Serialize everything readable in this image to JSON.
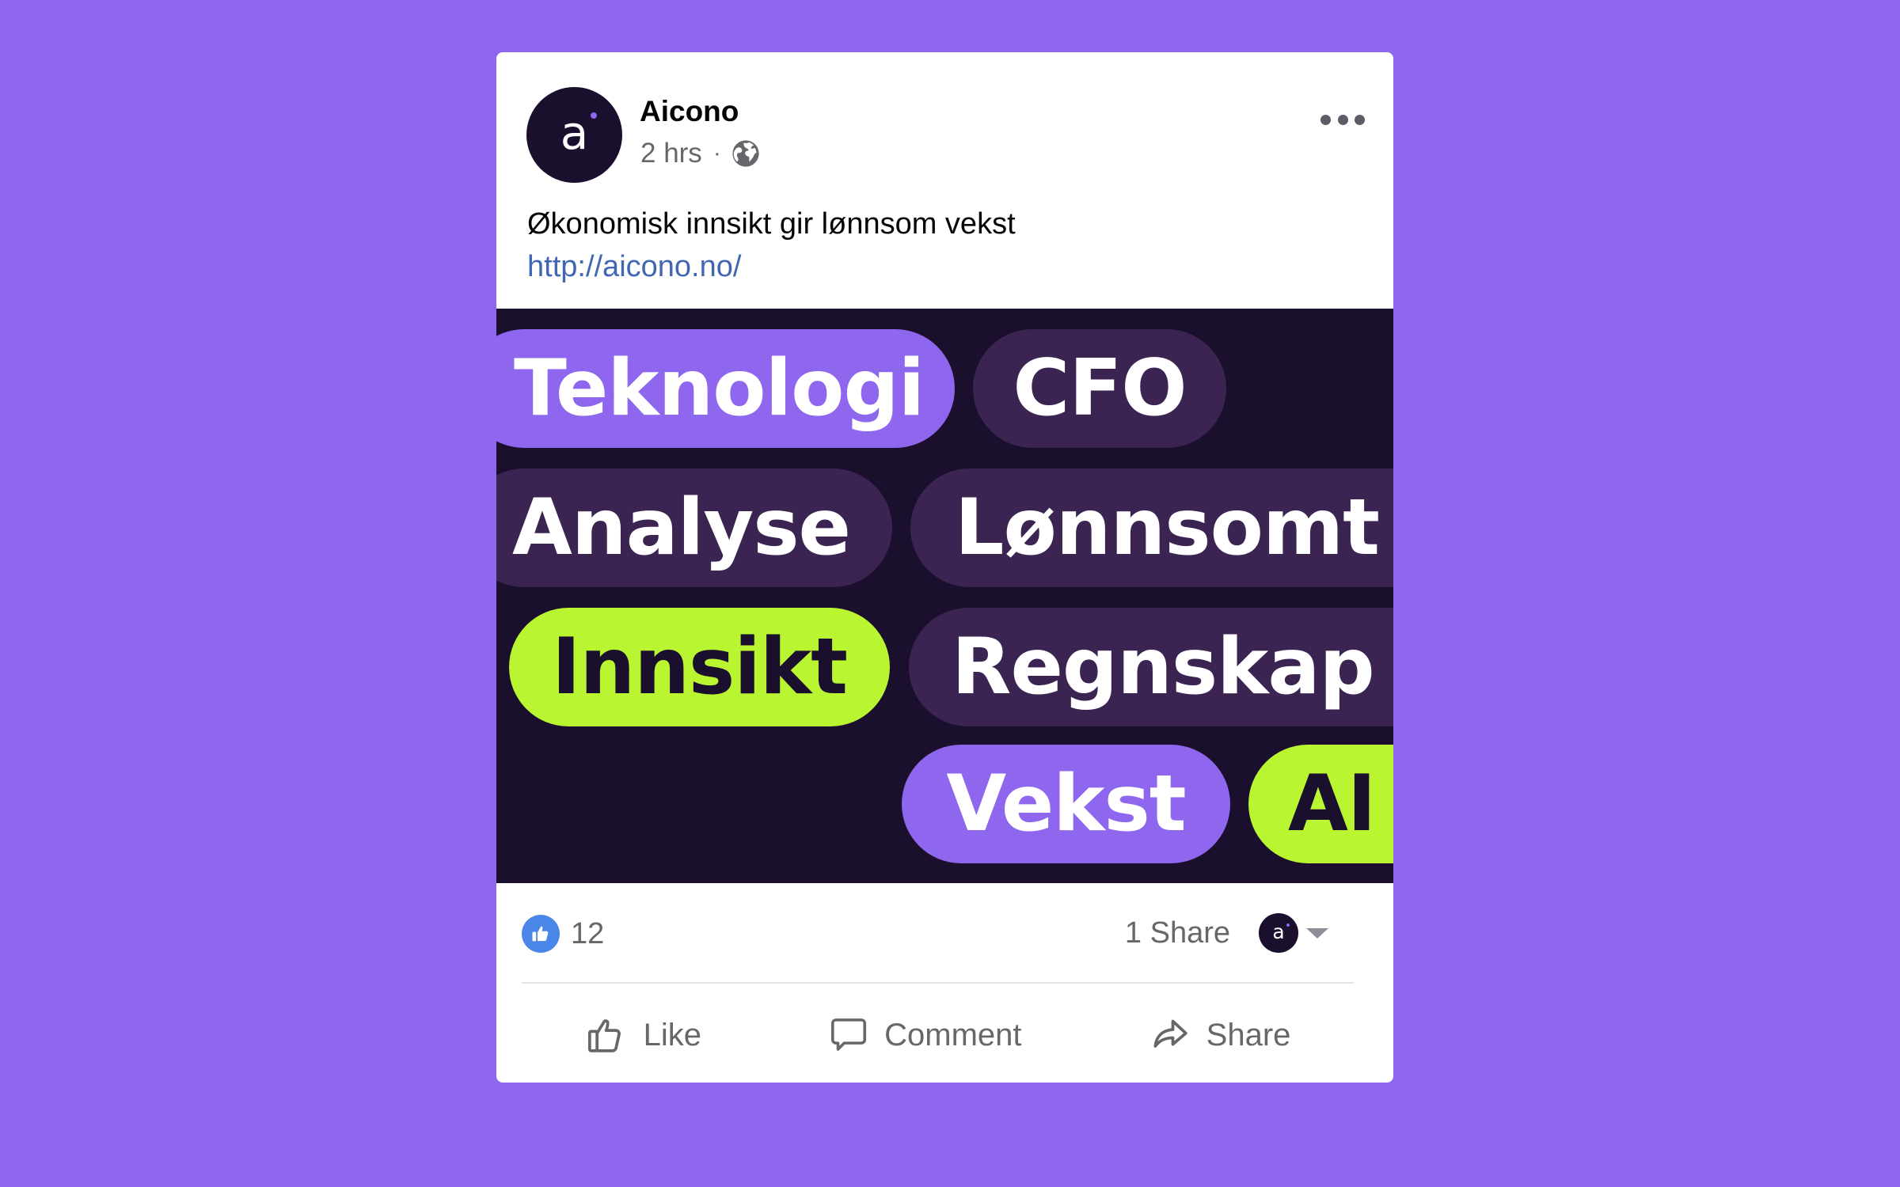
{
  "colors": {
    "background": "#8f66ee",
    "brand_dark": "#1b0f2e",
    "brand_purple": "#8f66ee",
    "brand_lime": "#baf532",
    "pill_dark": "#3b2452",
    "link": "#4267b2",
    "like_blue": "#4a86e8"
  },
  "post": {
    "author": {
      "name": "Aicono",
      "avatar_letter": "a",
      "avatar_icon": "aicono-logo"
    },
    "timestamp": "2 hrs",
    "separator": "·",
    "privacy_icon": "globe-icon",
    "more_icon": "more-options-icon",
    "text": "Økonomisk innsikt gir lønnsom vekst",
    "link": "http://aicono.no/"
  },
  "image": {
    "pills": [
      {
        "label": "Teknologi",
        "style": "purple"
      },
      {
        "label": "CFO",
        "style": "dark"
      },
      {
        "label": "Analyse",
        "style": "dark"
      },
      {
        "label": "Lønnsomt",
        "style": "dark"
      },
      {
        "label": "Innsikt",
        "style": "lime"
      },
      {
        "label": "Regnskap",
        "style": "dark"
      },
      {
        "label": "Vekst",
        "style": "purple"
      },
      {
        "label": "AI",
        "style": "lime"
      }
    ]
  },
  "stats": {
    "reaction_icon": "like-reaction-icon",
    "reactions_count": "12",
    "shares_label": "1 Share",
    "share_as_avatar_letter": "a"
  },
  "actions": {
    "like": "Like",
    "comment": "Comment",
    "share": "Share"
  }
}
